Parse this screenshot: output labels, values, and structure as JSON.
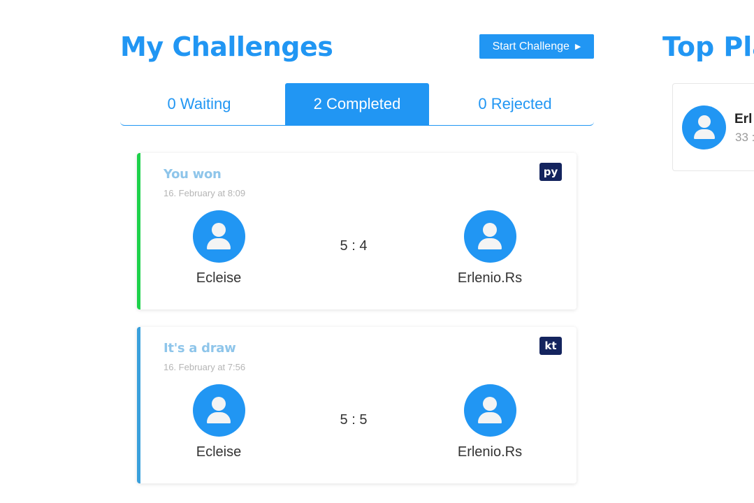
{
  "header": {
    "title": "My Challenges",
    "start_button_label": "Start Challenge",
    "start_button_icon": "play-triangle-icon"
  },
  "tabs": [
    {
      "label": "0 Waiting",
      "active": false
    },
    {
      "label": "2 Completed",
      "active": true
    },
    {
      "label": "0 Rejected",
      "active": false
    }
  ],
  "challenges": [
    {
      "result": "You won",
      "date": "16. February at 8:09",
      "language": "py",
      "status_color": "#1ed14b",
      "player1": "Ecleise",
      "player2": "Erlenio.Rs",
      "score": "5 : 4"
    },
    {
      "result": "It's a draw",
      "date": "16. February at 7:56",
      "language": "kt",
      "status_color": "#3aa0dc",
      "player1": "Ecleise",
      "player2": "Erlenio.Rs",
      "score": "5 : 5"
    }
  ],
  "top_players": {
    "title": "Top Pla",
    "first": {
      "name": "Erl",
      "score": "33 :"
    }
  },
  "colors": {
    "accent": "#2196f3",
    "badge_bg": "#14245e"
  }
}
